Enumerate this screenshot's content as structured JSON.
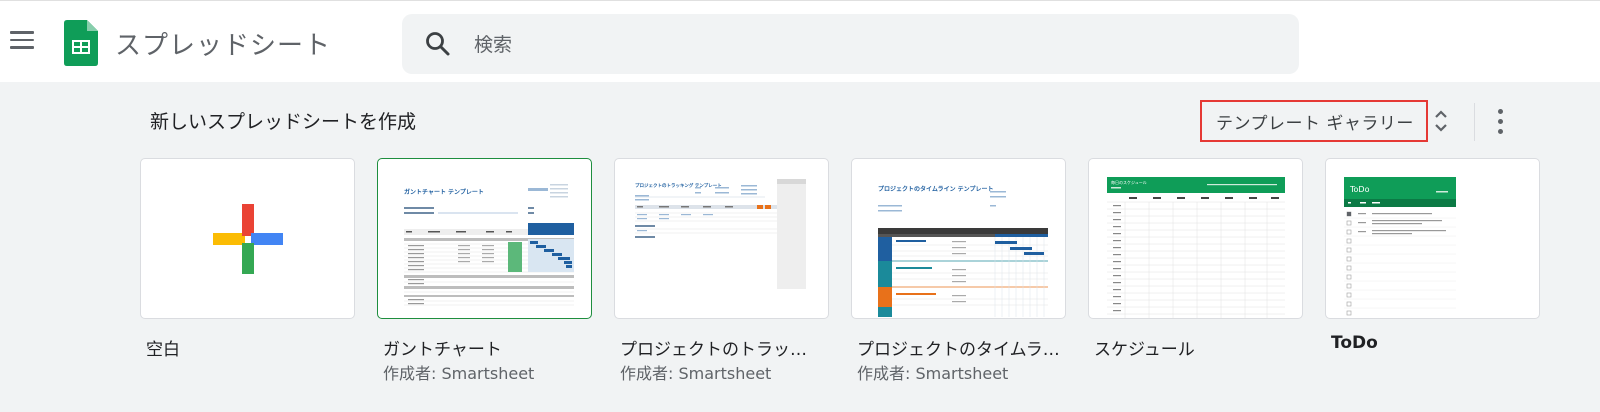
{
  "app": {
    "title": "スプレッドシート"
  },
  "search": {
    "placeholder": "検索"
  },
  "section": {
    "title": "新しいスプレッドシートを作成",
    "gallery_label": "テンプレート ギャラリー"
  },
  "templates": [
    {
      "name": "空白",
      "author": ""
    },
    {
      "name": "ガントチャート",
      "author": "作成者: Smartsheet",
      "thumb_title": "ガントチャート テンプレート"
    },
    {
      "name": "プロジェクトのトラッ…",
      "author": "作成者: Smartsheet",
      "thumb_title": "プロジェクトのトラッキング テンプレート"
    },
    {
      "name": "プロジェクトのタイムラ…",
      "author": "作成者: Smartsheet",
      "thumb_title": "プロジェクトのタイムライン テンプレート"
    },
    {
      "name": "スケジュール",
      "author": "",
      "thumb_title": "毎日のスケジュール"
    },
    {
      "name": "ToDo",
      "author": "",
      "thumb_title": "ToDo"
    }
  ],
  "colors": {
    "sheets_green": "#0f9d58",
    "selection_red": "#e53935",
    "gantt_blue": "#1f5fa0"
  }
}
